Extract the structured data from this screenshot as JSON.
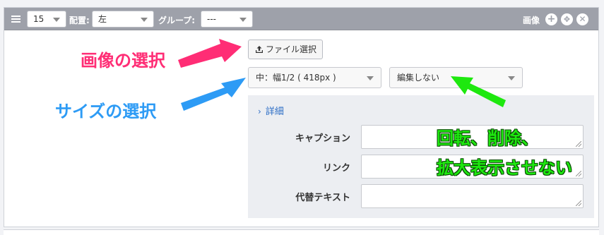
{
  "header": {
    "count_select": "15",
    "align_label": "配置:",
    "align_select": "左",
    "group_label": "グループ:",
    "group_select": "---",
    "type_label": "画像",
    "icons": [
      "plus-circle-icon",
      "move-icon",
      "close-circle-icon"
    ]
  },
  "image": {
    "file_button_label": "ファイル選択",
    "size_select": "中：幅1/2 ( 418px )",
    "edit_select": "編集しない"
  },
  "details": {
    "toggle_label": "詳細",
    "fields": [
      {
        "label": "キャプション",
        "value": ""
      },
      {
        "label": "リンク",
        "value": ""
      },
      {
        "label": "代替テキスト",
        "value": ""
      }
    ]
  },
  "annotations": {
    "image_select": "画像の選択",
    "size_select": "サイズの選択",
    "no_edit_line1": "回転、削除、",
    "no_edit_line2": "拡大表示させない"
  },
  "colors": {
    "header_bg": "#9ea1aa",
    "annotation_pink": "#ff2d75",
    "annotation_blue": "#2d9bf5",
    "annotation_green": "#1ee80f",
    "link": "#2d6ec6"
  }
}
